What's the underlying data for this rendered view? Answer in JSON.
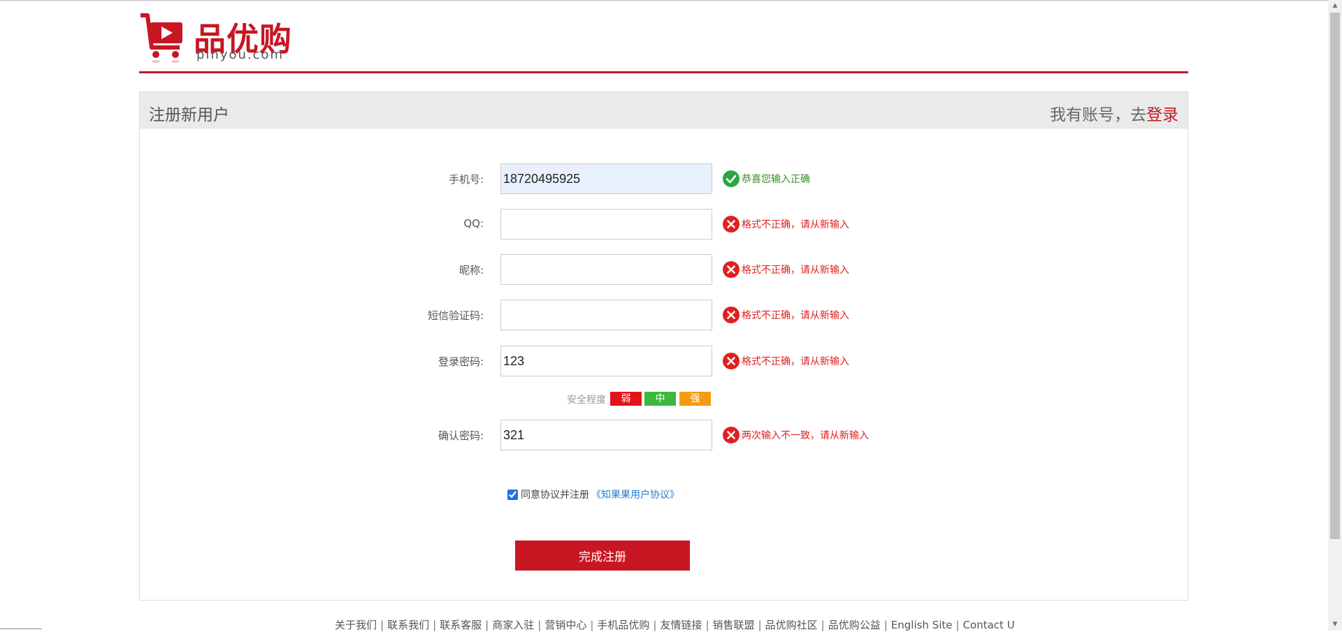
{
  "brand": {
    "name": "品优购",
    "domain": "pinyou.com",
    "color": "#c81623"
  },
  "panel": {
    "title": "注册新用户",
    "login_prompt": "我有账号，去",
    "login_link": "登录"
  },
  "form": {
    "phone": {
      "label": "手机号:",
      "value": "18720495925",
      "message": "恭喜您输入正确",
      "status": "success"
    },
    "qq": {
      "label": "QQ:",
      "value": "",
      "message": "格式不正确，请从新输入",
      "status": "error"
    },
    "nickname": {
      "label": "昵称:",
      "value": "",
      "message": "格式不正确，请从新输入",
      "status": "error"
    },
    "sms_code": {
      "label": "短信验证码:",
      "value": "",
      "message": "格式不正确，请从新输入",
      "status": "error"
    },
    "password": {
      "label": "登录密码:",
      "value": "123",
      "message": "格式不正确，请从新输入",
      "status": "error"
    },
    "strength": {
      "label": "安全程度",
      "weak": "弱",
      "medium": "中",
      "strong": "强"
    },
    "confirm_password": {
      "label": "确认密码:",
      "value": "321",
      "message": "两次输入不一致，请从新输入",
      "status": "error"
    },
    "agree": {
      "checked": true,
      "text": "同意协议并注册",
      "link": "《知果果用户协议》"
    },
    "submit_label": "完成注册"
  },
  "footer": {
    "links": [
      "关于我们",
      "联系我们",
      "联系客服",
      "商家入驻",
      "营销中心",
      "手机品优购",
      "友情链接",
      "销售联盟",
      "品优购社区",
      "品优购公益",
      "English Site",
      "Contact U"
    ]
  },
  "colors": {
    "success": "#3a8a2a",
    "error": "#e02020",
    "accent": "#c81623",
    "link": "#2a7ad1"
  },
  "icons": {
    "success": "check-circle-icon",
    "error": "error-circle-icon",
    "cart": "shopping-cart-icon"
  }
}
